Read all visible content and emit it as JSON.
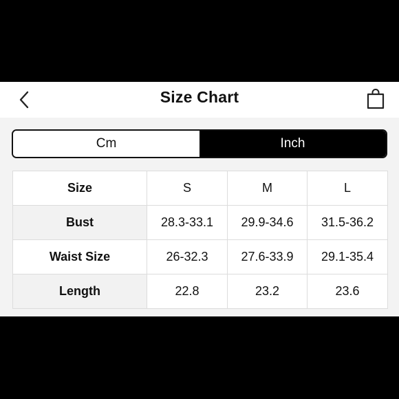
{
  "header": {
    "title": "Size Chart",
    "back_icon": "chevron-left-icon",
    "cart_icon": "shopping-bag-icon"
  },
  "unit_toggle": {
    "options": [
      "Cm",
      "Inch"
    ],
    "selected": "Inch"
  },
  "table": {
    "header_label": "Size",
    "sizes": [
      "S",
      "M",
      "L"
    ],
    "rows": [
      {
        "label": "Bust",
        "values": [
          "28.3-33.1",
          "29.9-34.6",
          "31.5-36.2"
        ]
      },
      {
        "label": "Waist Size",
        "values": [
          "26-32.3",
          "27.6-33.9",
          "29.1-35.4"
        ]
      },
      {
        "label": "Length",
        "values": [
          "22.8",
          "23.2",
          "23.6"
        ]
      }
    ]
  },
  "colors": {
    "selected_bg": "#000000",
    "selected_text": "#ffffff",
    "border": "#111111",
    "cell_border": "#dcdcdc",
    "label_bg": "#f2f2f2"
  }
}
